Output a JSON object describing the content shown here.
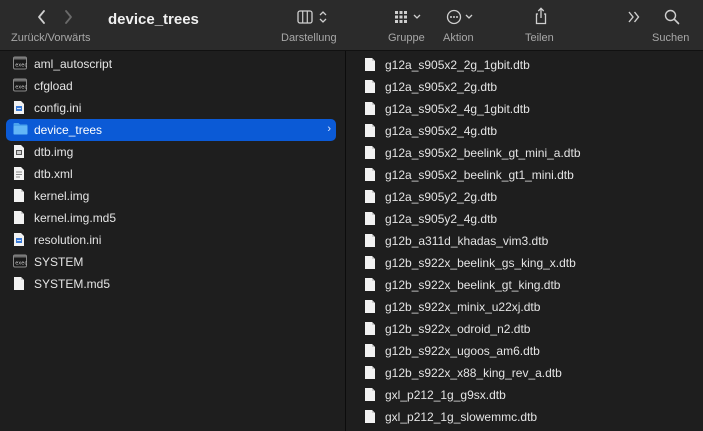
{
  "toolbar": {
    "title": "device_trees",
    "nav_label": "Zurück/Vorwärts",
    "view_label": "Darstellung",
    "group_label": "Gruppe",
    "action_label": "Aktion",
    "share_label": "Teilen",
    "search_label": "Suchen"
  },
  "left_column": {
    "items": [
      {
        "name": "aml_autoscript",
        "icon": "terminal-file-icon"
      },
      {
        "name": "cfgload",
        "icon": "terminal-file-icon"
      },
      {
        "name": "config.ini",
        "icon": "ini-file-icon"
      },
      {
        "name": "device_trees",
        "icon": "folder-icon",
        "selected": true
      },
      {
        "name": "dtb.img",
        "icon": "image-file-icon"
      },
      {
        "name": "dtb.xml",
        "icon": "xml-file-icon"
      },
      {
        "name": "kernel.img",
        "icon": "document-icon"
      },
      {
        "name": "kernel.img.md5",
        "icon": "document-icon"
      },
      {
        "name": "resolution.ini",
        "icon": "ini-file-icon"
      },
      {
        "name": "SYSTEM",
        "icon": "terminal-file-icon"
      },
      {
        "name": "SYSTEM.md5",
        "icon": "document-icon"
      }
    ]
  },
  "right_column": {
    "items": [
      "g12a_s905x2_2g_1gbit.dtb",
      "g12a_s905x2_2g.dtb",
      "g12a_s905x2_4g_1gbit.dtb",
      "g12a_s905x2_4g.dtb",
      "g12a_s905x2_beelink_gt_mini_a.dtb",
      "g12a_s905x2_beelink_gt1_mini.dtb",
      "g12a_s905y2_2g.dtb",
      "g12a_s905y2_4g.dtb",
      "g12b_a311d_khadas_vim3.dtb",
      "g12b_s922x_beelink_gs_king_x.dtb",
      "g12b_s922x_beelink_gt_king.dtb",
      "g12b_s922x_minix_u22xj.dtb",
      "g12b_s922x_odroid_n2.dtb",
      "g12b_s922x_ugoos_am6.dtb",
      "g12b_s922x_x88_king_rev_a.dtb",
      "gxl_p212_1g_g9sx.dtb",
      "gxl_p212_1g_slowemmc.dtb"
    ]
  },
  "colors": {
    "selection": "#0b5ad6",
    "folder": "#4aa3ee",
    "toolbar_bg": "#2b2b2b",
    "window_bg": "#1e1e1e"
  }
}
